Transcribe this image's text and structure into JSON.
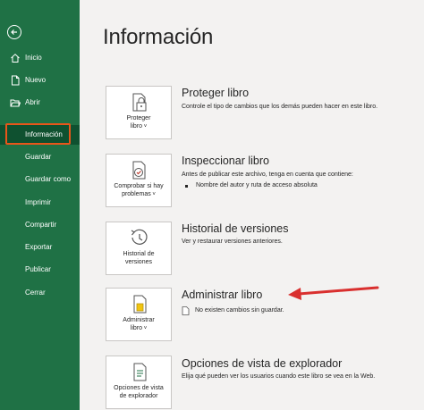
{
  "sidebar": {
    "items": [
      {
        "label": "Inicio",
        "icon": "home-icon"
      },
      {
        "label": "Nuevo",
        "icon": "new-document-icon"
      },
      {
        "label": "Abrir",
        "icon": "folder-open-icon"
      },
      {
        "label": "Información"
      },
      {
        "label": "Guardar"
      },
      {
        "label": "Guardar como"
      },
      {
        "label": "Imprimir"
      },
      {
        "label": "Compartir"
      },
      {
        "label": "Exportar"
      },
      {
        "label": "Publicar"
      },
      {
        "label": "Cerrar"
      }
    ],
    "active_index": 3
  },
  "main": {
    "title": "Información",
    "sections": [
      {
        "button_lines": [
          "Proteger",
          "libro"
        ],
        "icon": "lock-document-icon",
        "title": "Proteger libro",
        "description": "Controle el tipo de cambios que los demás pueden hacer en este libro."
      },
      {
        "button_lines": [
          "Comprobar si hay",
          "problemas"
        ],
        "icon": "check-document-icon",
        "title": "Inspeccionar libro",
        "description": "Antes de publicar este archivo, tenga en cuenta que contiene:",
        "bullets": [
          "Nombre del autor y ruta de acceso absoluta"
        ]
      },
      {
        "button_lines": [
          "Historial de",
          "versiones"
        ],
        "icon": "history-icon",
        "title": "Historial de versiones",
        "description": "Ver y restaurar versiones anteriores."
      },
      {
        "button_lines": [
          "Administrar",
          "libro"
        ],
        "icon": "manage-workbook-icon",
        "title": "Administrar libro",
        "description": "No existen cambios sin guardar."
      },
      {
        "button_lines": [
          "Opciones de vista",
          "de explorador"
        ],
        "icon": "browser-view-icon",
        "title": "Opciones de vista de explorador",
        "description": "Elija qué pueden ver los usuarios cuando este libro se vea en la Web."
      }
    ]
  },
  "colors": {
    "sidebar_bg": "#1f7145",
    "sidebar_active_bg": "#0f5130",
    "highlight_box": "#e8561a",
    "annotation_arrow": "#d9302f"
  },
  "annotation": {
    "type": "arrow",
    "target": "Administrar libro"
  }
}
